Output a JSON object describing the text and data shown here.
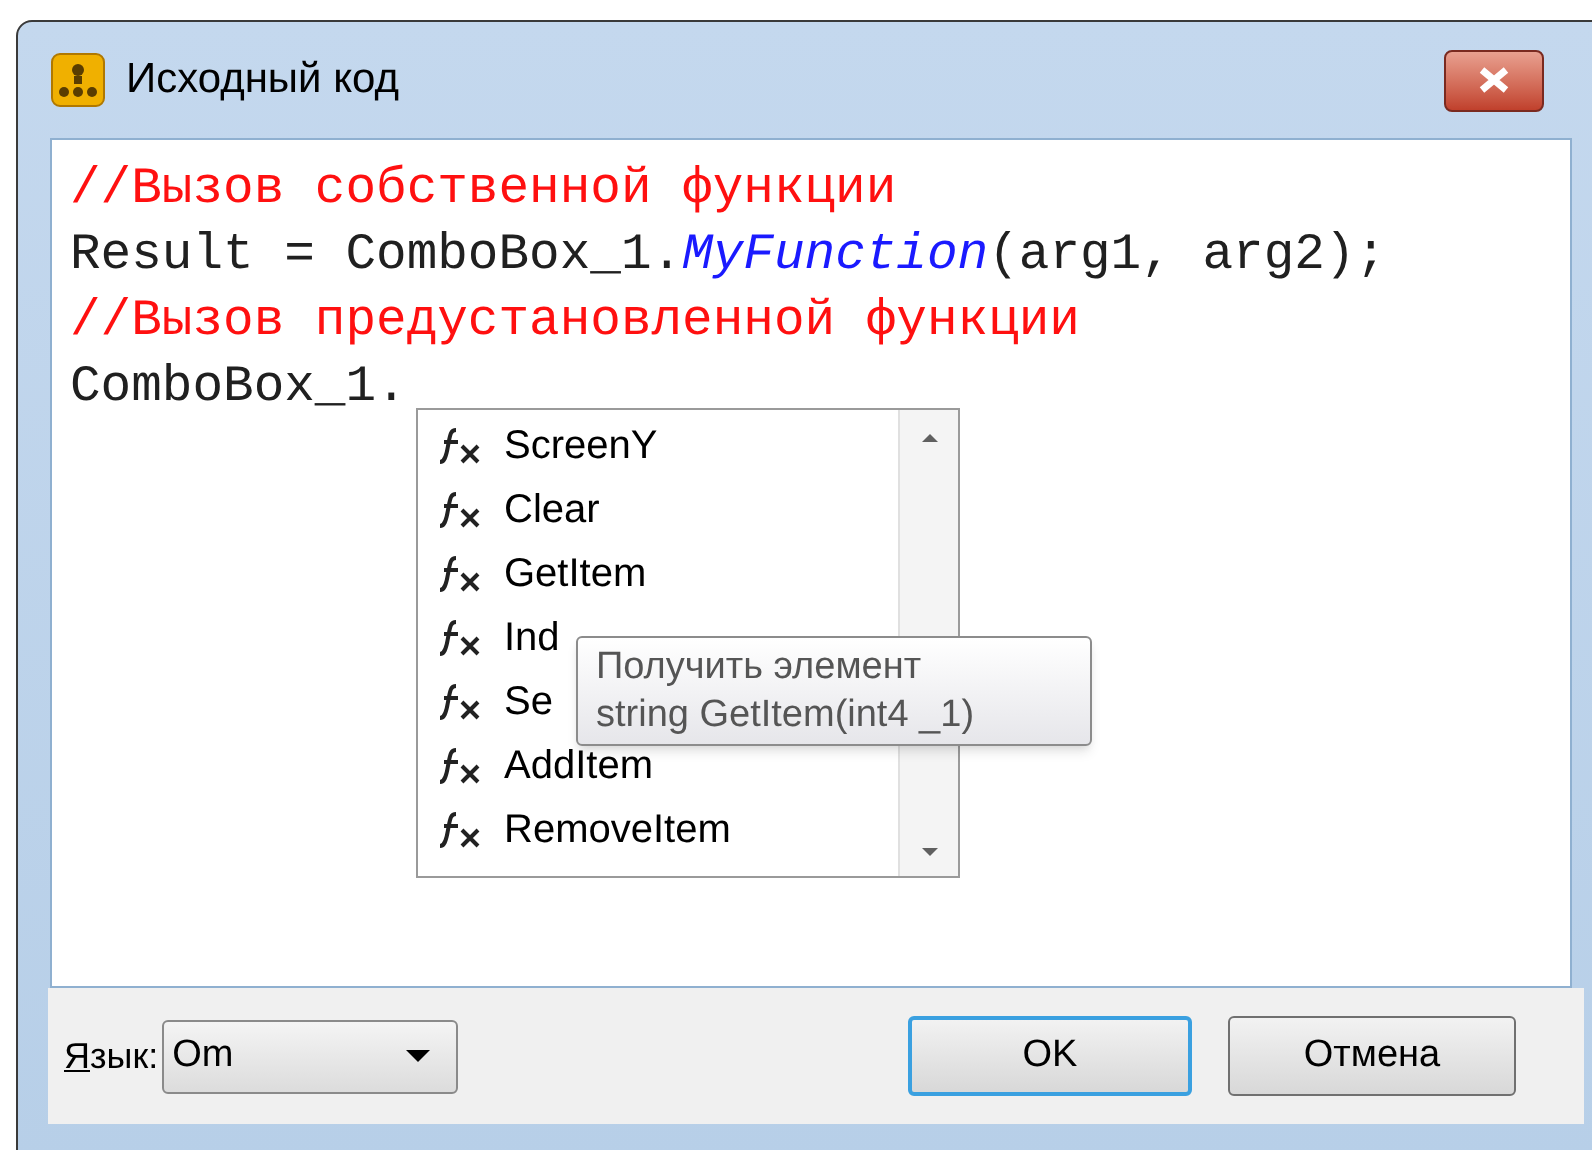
{
  "window": {
    "title": "Исходный код"
  },
  "code_lines": [
    {
      "kind": "comment",
      "text": "//Вызов собственной функции"
    },
    {
      "kind": "call",
      "before": "Result = ComboBox_1.",
      "function": "MyFunction",
      "after": "(arg1, arg2);"
    },
    {
      "kind": "comment",
      "text": "//Вызов предустановленной функции"
    },
    {
      "kind": "plain",
      "text": "ComboBox_1."
    }
  ],
  "completion_list": {
    "items": [
      "ScreenY",
      "Clear",
      "GetItem",
      "Ind",
      "Se",
      "AddItem",
      "RemoveItem"
    ]
  },
  "tooltip": {
    "lines": [
      "Получить элемент",
      "string GetItem(int4 _1)"
    ]
  },
  "language": {
    "label": "Язык:",
    "value": "Om"
  },
  "buttons": [
    {
      "label": "OK",
      "default": true
    },
    {
      "label": "Отмена",
      "default": false
    }
  ]
}
